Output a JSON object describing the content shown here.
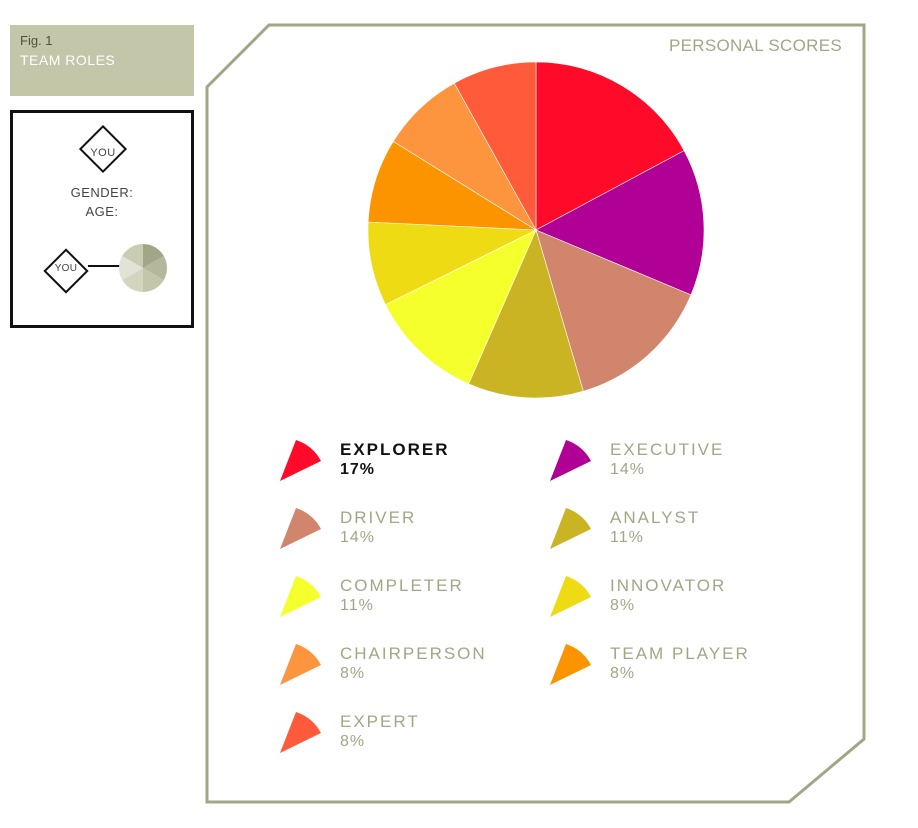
{
  "figure": {
    "label": "Fig. 1",
    "title": "TEAM ROLES"
  },
  "profile": {
    "you_label": "YOU",
    "gender_label": "GENDER:",
    "age_label": "AGE:"
  },
  "colors": {
    "frame_border": "#a3a686",
    "muted_text": "#a3a686",
    "fig_box_bg": "#c4c6a9"
  },
  "chart_data": {
    "type": "pie",
    "title": "PERSONAL SCORES",
    "legend_placement": "bottom",
    "slices": [
      {
        "label": "EXPLORER",
        "percent_label": "17%",
        "value": 17,
        "color": "#ff0a28",
        "highlighted": true
      },
      {
        "label": "EXECUTIVE",
        "percent_label": "14%",
        "value": 14,
        "color": "#b00096",
        "highlighted": false
      },
      {
        "label": "DRIVER",
        "percent_label": "14%",
        "value": 14,
        "color": "#d0856c",
        "highlighted": false
      },
      {
        "label": "ANALYST",
        "percent_label": "11%",
        "value": 11,
        "color": "#cbb424",
        "highlighted": false
      },
      {
        "label": "COMPLETER",
        "percent_label": "11%",
        "value": 11,
        "color": "#f4ff2c",
        "highlighted": false
      },
      {
        "label": "INNOVATOR",
        "percent_label": "8%",
        "value": 8,
        "color": "#eedb14",
        "highlighted": false
      },
      {
        "label": "TEAM PLAYER",
        "percent_label": "8%",
        "value": 8,
        "color": "#fc9400",
        "highlighted": false
      },
      {
        "label": "CHAIRPERSON",
        "percent_label": "8%",
        "value": 8,
        "color": "#fd953e",
        "highlighted": false
      },
      {
        "label": "EXPERT",
        "percent_label": "8%",
        "value": 8,
        "color": "#ff5a3a",
        "highlighted": false
      }
    ],
    "legend_order": [
      "EXPLORER",
      "EXECUTIVE",
      "DRIVER",
      "ANALYST",
      "COMPLETER",
      "INNOVATOR",
      "CHAIRPERSON",
      "TEAM PLAYER",
      "EXPERT"
    ]
  }
}
